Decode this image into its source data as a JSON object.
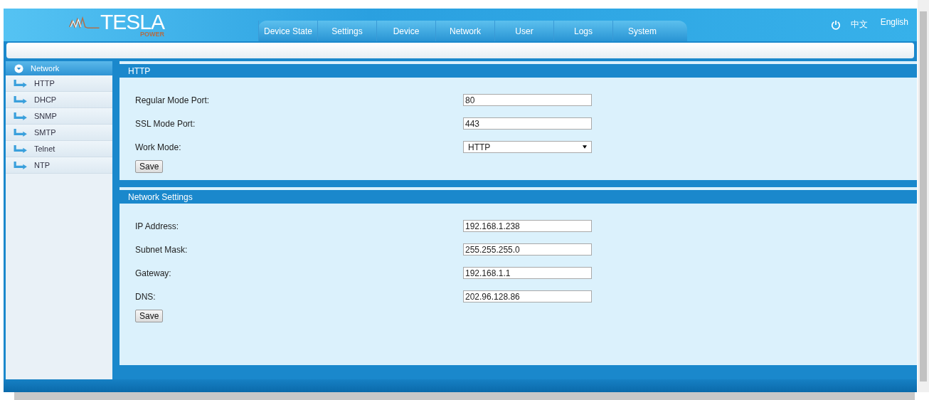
{
  "logo": {
    "name": "TESLA",
    "tagline": "POWER"
  },
  "tabs": [
    {
      "label": "Device State",
      "selected": false
    },
    {
      "label": "Settings",
      "selected": false
    },
    {
      "label": "Device",
      "selected": false
    },
    {
      "label": "Network",
      "selected": false
    },
    {
      "label": "User",
      "selected": false
    },
    {
      "label": "Logs",
      "selected": false
    },
    {
      "label": "System",
      "selected": false
    }
  ],
  "languages": [
    {
      "label": "中文"
    },
    {
      "label": "English"
    }
  ],
  "sidebar": {
    "items": [
      {
        "label": "Network",
        "expanded": true,
        "children": [
          {
            "label": "HTTP"
          },
          {
            "label": "DHCP"
          },
          {
            "label": "SNMP"
          },
          {
            "label": "SMTP"
          },
          {
            "label": "Telnet"
          },
          {
            "label": "NTP"
          }
        ]
      }
    ]
  },
  "sections": [
    {
      "title": "HTTP",
      "fields": [
        {
          "kind": "text",
          "label": "Regular Mode Port:",
          "value": "80"
        },
        {
          "kind": "text",
          "label": "SSL Mode Port:",
          "value": "443"
        },
        {
          "kind": "select",
          "label": "Work Mode:",
          "value": "HTTP"
        }
      ],
      "button": "Save"
    },
    {
      "title": "Network Settings",
      "fields": [
        {
          "kind": "text",
          "label": "IP Address:",
          "value": "192.168.1.238"
        },
        {
          "kind": "text",
          "label": "Subnet Mask:",
          "value": "255.255.255.0"
        },
        {
          "kind": "text",
          "label": "Gateway:",
          "value": "192.168.1.1"
        },
        {
          "kind": "text",
          "label": "DNS:",
          "value": "202.96.128.86"
        }
      ],
      "button": "Save"
    }
  ]
}
